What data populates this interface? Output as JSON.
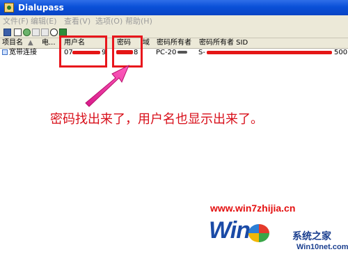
{
  "window": {
    "title": "Dialupass"
  },
  "menu": [
    "文件(F)",
    "编辑(E)",
    "查看(V)",
    "选项(O)",
    "帮助(H)"
  ],
  "toolbar_icons": [
    "save-icon",
    "properties-icon",
    "refresh-icon",
    "copy-icon",
    "html-report-icon",
    "find-icon",
    "exit-icon"
  ],
  "table": {
    "columns": [
      "项目名",
      "电...",
      "用户名",
      "密码",
      "域",
      "密码所有者",
      "密码所有者 SID"
    ],
    "rows": [
      {
        "entry": "宽带连接",
        "user": "07",
        "user_tail": "9",
        "password_tail": "8",
        "owner": "PC-20",
        "sid": "S-",
        "sid_tail": "500"
      }
    ]
  },
  "annotation": {
    "caption": "密码找出来了，用户名也显示出来了。"
  },
  "colors": {
    "title_bar": "#0a50d8",
    "highlight": "#e8161c",
    "caption": "#d80f1a"
  },
  "watermark": {
    "url": "www.win7zhijia.cn",
    "logo_text": "Win",
    "brand_cn": "系统之家",
    "brand_en": "Win10net.com"
  }
}
